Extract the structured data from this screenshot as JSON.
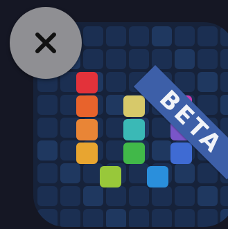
{
  "app_icon": {
    "badge_label": "BETA",
    "colors": {
      "background": "#151724",
      "icon_base": "#16223a",
      "ribbon": "#3d5fa8",
      "close_button": "#8f8f93",
      "close_glyph": "#111111"
    },
    "tile_colors": {
      "red": "#e3323a",
      "orange": "#e8632c",
      "amber": "#e98536",
      "yellow": "#e8a530",
      "lime": "#98c83a",
      "khaki": "#d7c96a",
      "teal": "#3ab9b6",
      "green": "#41b849",
      "blue": "#2a8fdc",
      "magenta": "#c93fb2",
      "purple": "#7a55c9",
      "indigo": "#3f6bd3"
    }
  },
  "close_button": {
    "icon": "close-icon"
  }
}
